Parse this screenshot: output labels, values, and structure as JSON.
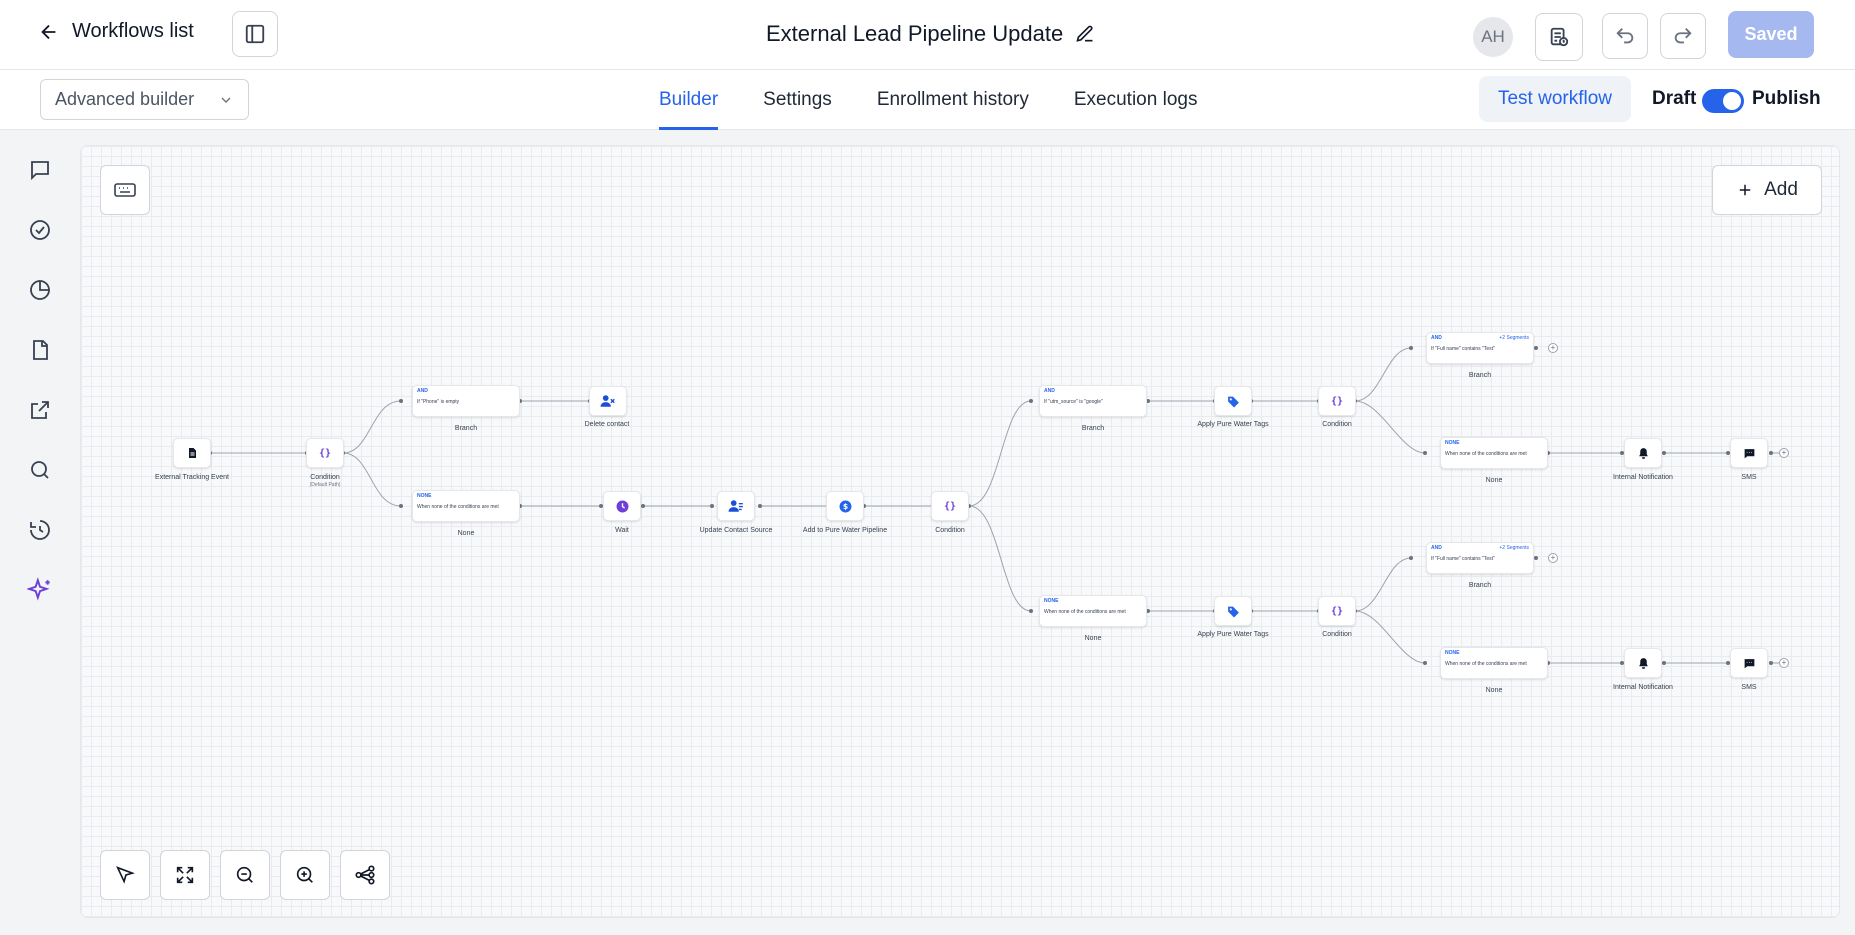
{
  "header": {
    "back_label": "Workflows list",
    "title": "External Lead Pipeline Update",
    "avatar_initials": "AH",
    "saved_label": "Saved"
  },
  "subbar": {
    "builder_select": "Advanced builder",
    "tabs": [
      {
        "label": "Builder",
        "active": true
      },
      {
        "label": "Settings",
        "active": false
      },
      {
        "label": "Enrollment history",
        "active": false
      },
      {
        "label": "Execution logs",
        "active": false
      }
    ],
    "test_workflow": "Test workflow",
    "draft_label": "Draft",
    "publish_label": "Publish",
    "publish_enabled": true
  },
  "sidebar": [
    "chat-icon",
    "check-circle-icon",
    "pie-chart-icon",
    "file-icon",
    "external-link-icon",
    "search-icon",
    "history-icon",
    "sparkles-icon"
  ],
  "canvas": {
    "add_label": "Add",
    "tools": [
      "pointer-icon",
      "fit-view-icon",
      "zoom-out-icon",
      "zoom-in-icon",
      "auto-layout-icon"
    ]
  },
  "workflow": {
    "trigger": {
      "label": "External Tracking Event",
      "icon": "document-icon"
    },
    "condition_main": {
      "label": "Condition",
      "sublabel": "(Default Path)",
      "icon": "braces-icon"
    },
    "branch_phone": {
      "badge": "AND",
      "text": "If \"Phone\" is empty",
      "label": "Branch"
    },
    "delete_contact": {
      "label": "Delete contact",
      "icon": "user-x-icon"
    },
    "none_main": {
      "badge": "NONE",
      "text": "When none of the conditions are met",
      "label": "None"
    },
    "wait": {
      "label": "Wait",
      "icon": "clock-icon"
    },
    "update_source": {
      "label": "Update Contact Source",
      "icon": "user-edit-icon"
    },
    "add_pipeline": {
      "label": "Add to Pure Water Pipeline",
      "icon": "dollar-icon"
    },
    "condition_mid": {
      "label": "Condition",
      "icon": "braces-icon"
    },
    "branch_utm": {
      "badge": "AND",
      "text": "If \"utm_source\" is \"google\"",
      "label": "Branch"
    },
    "tags_top": {
      "label": "Apply Pure Water Tags",
      "icon": "tag-icon"
    },
    "condition_top": {
      "label": "Condition",
      "icon": "braces-icon"
    },
    "branch_top_a": {
      "badge": "AND",
      "segments": "+2 Segments",
      "text": "If \"Full name\" contains \"Test\"",
      "label": "Branch"
    },
    "none_top_b": {
      "badge": "NONE",
      "text": "When none of the conditions are met",
      "label": "None"
    },
    "notify_top": {
      "label": "Internal Notification",
      "icon": "bell-icon"
    },
    "sms_top": {
      "label": "SMS",
      "icon": "message-icon"
    },
    "none_mid": {
      "badge": "NONE",
      "text": "When none of the conditions are met",
      "label": "None"
    },
    "tags_bottom": {
      "label": "Apply Pure Water Tags",
      "icon": "tag-icon"
    },
    "condition_bottom": {
      "label": "Condition",
      "icon": "braces-icon"
    },
    "branch_bottom_a": {
      "badge": "AND",
      "segments": "+2 Segments",
      "text": "If \"Full name\" contains \"Test\"",
      "label": "Branch"
    },
    "none_bottom_b": {
      "badge": "NONE",
      "text": "When none of the conditions are met",
      "label": "None"
    },
    "notify_bottom": {
      "label": "Internal Notification",
      "icon": "bell-icon"
    },
    "sms_bottom": {
      "label": "SMS",
      "icon": "message-icon"
    }
  },
  "colors": {
    "accent": "#2563eb",
    "saved_bg": "#a5b8f0",
    "purple": "#6d3fd6"
  }
}
